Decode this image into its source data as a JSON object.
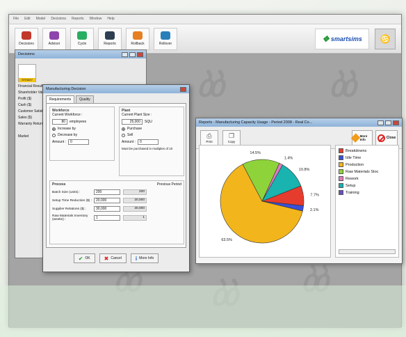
{
  "menu": [
    "File",
    "Edit",
    "Model",
    "Decisions",
    "Reports",
    "Window",
    "Help"
  ],
  "toolbar": [
    {
      "label": "Decisions",
      "icon": "decisions-icon",
      "color": "#c0392b"
    },
    {
      "label": "Advisor",
      "icon": "advisor-icon",
      "color": "#8e44ad"
    },
    {
      "label": "Cycle",
      "icon": "cycle-icon",
      "color": "#27ae60"
    },
    {
      "label": "Reports",
      "icon": "reports-icon",
      "color": "#2c3e50"
    },
    {
      "label": "Rollback",
      "icon": "rollback-icon",
      "color": "#e67e22"
    },
    {
      "label": "Rollover",
      "icon": "rollover-icon",
      "color": "#2980b9"
    }
  ],
  "logo": {
    "text": "smartsims"
  },
  "decisions": {
    "title": "Decisions",
    "status": "STEADY",
    "items": [
      "Financial Results",
      "Shareholder Value",
      "Profit ($)",
      "Cash ($)",
      "Customer Satisfaction",
      "Sales ($)",
      "Warranty Returns"
    ],
    "market_label": "Market"
  },
  "mfg": {
    "title": "Manufacturing Decision",
    "tabs": [
      "Requirements",
      "Quality"
    ],
    "workforce": {
      "label": "Workforce",
      "current_label": "Current Workforce :",
      "current_value": "80",
      "unit": "employees",
      "opt1": "Increase by",
      "opt2": "Decrease by",
      "amount_label": "Amount :",
      "amount_value": "0"
    },
    "plant": {
      "label": "Plant",
      "current_label": "Current Plant Size :",
      "current_value": "25,000",
      "unit": "SQU",
      "opt1": "Purchase",
      "opt2": "Sell",
      "amount_label": "Amount :",
      "amount_value": "0",
      "note": "Must be purchased in multiples of 10"
    },
    "process": {
      "label": "Process",
      "prev_header": "Previous Period",
      "rows": [
        {
          "label": "Batch Size (units) :",
          "value": "200",
          "prev": "200"
        },
        {
          "label": "Setup Time Reduction ($) :",
          "value": "20,000",
          "prev": "20,000"
        },
        {
          "label": "Supplier Relations ($) :",
          "value": "30,000",
          "prev": "30,000"
        },
        {
          "label": "Raw Materials Inventory (weeks) :",
          "value": "1",
          "prev": "1"
        }
      ]
    },
    "buttons": {
      "ok": "OK",
      "cancel": "Cancel",
      "more": "More Info"
    }
  },
  "reports": {
    "title": "Reports - Manufacturing Capacity Usage - Period 2008 - Real Co...",
    "print_label": "Print",
    "copy_label": "Copy",
    "more_label": "More Info",
    "close_label": "Close"
  },
  "chart_data": {
    "type": "pie",
    "categories": [
      "Breakdowns",
      "Idle Time",
      "Production",
      "Raw Materials Stoc",
      "Rework",
      "Setup",
      "Training"
    ],
    "values": [
      7.7,
      2.1,
      63.5,
      14.5,
      1.4,
      10.8,
      0.0
    ],
    "labels": [
      "7.7%",
      "2.1%",
      "63.5%",
      "14.5%",
      "1.4%",
      "10.8%",
      ""
    ],
    "colors": [
      "#e63c2e",
      "#3a4fd8",
      "#f2b51c",
      "#8fd33b",
      "#e07cc0",
      "#19b3b0",
      "#6b4fbf"
    ]
  }
}
